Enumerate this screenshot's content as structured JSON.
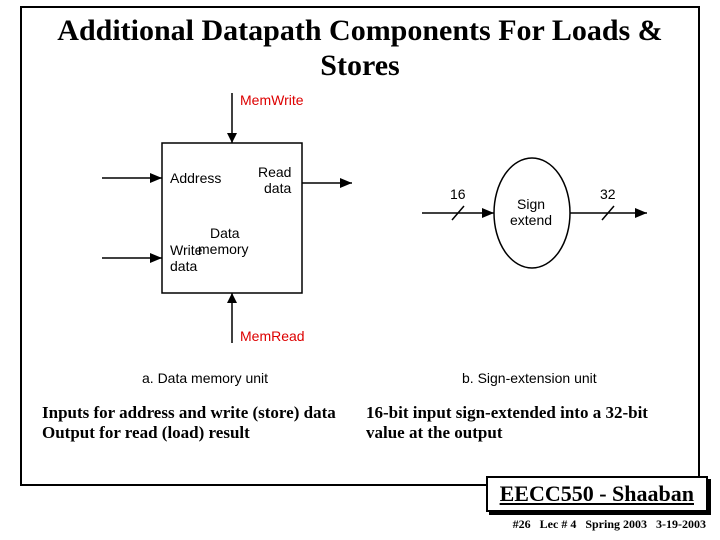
{
  "title": "Additional Datapath Components For Loads & Stores",
  "data_memory": {
    "memwrite": "MemWrite",
    "memread": "MemRead",
    "address": "Address",
    "writedata": "Write data",
    "readdata": "Read data",
    "datamemory": "Data memory",
    "label": "a. Data memory unit"
  },
  "sign_extend": {
    "in_width": "16",
    "out_width": "32",
    "name": "Sign extend",
    "label": "b. Sign-extension unit"
  },
  "captions": {
    "left": "Inputs for address and write (store) data\nOutput for read (load) result",
    "right": "16-bit input sign-extended into a 32-bit value at the output"
  },
  "course": "EECC550 - Shaaban",
  "footer": {
    "slide": "#26",
    "lecture": "Lec # 4",
    "term": "Spring 2003",
    "date": "3-19-2003"
  }
}
